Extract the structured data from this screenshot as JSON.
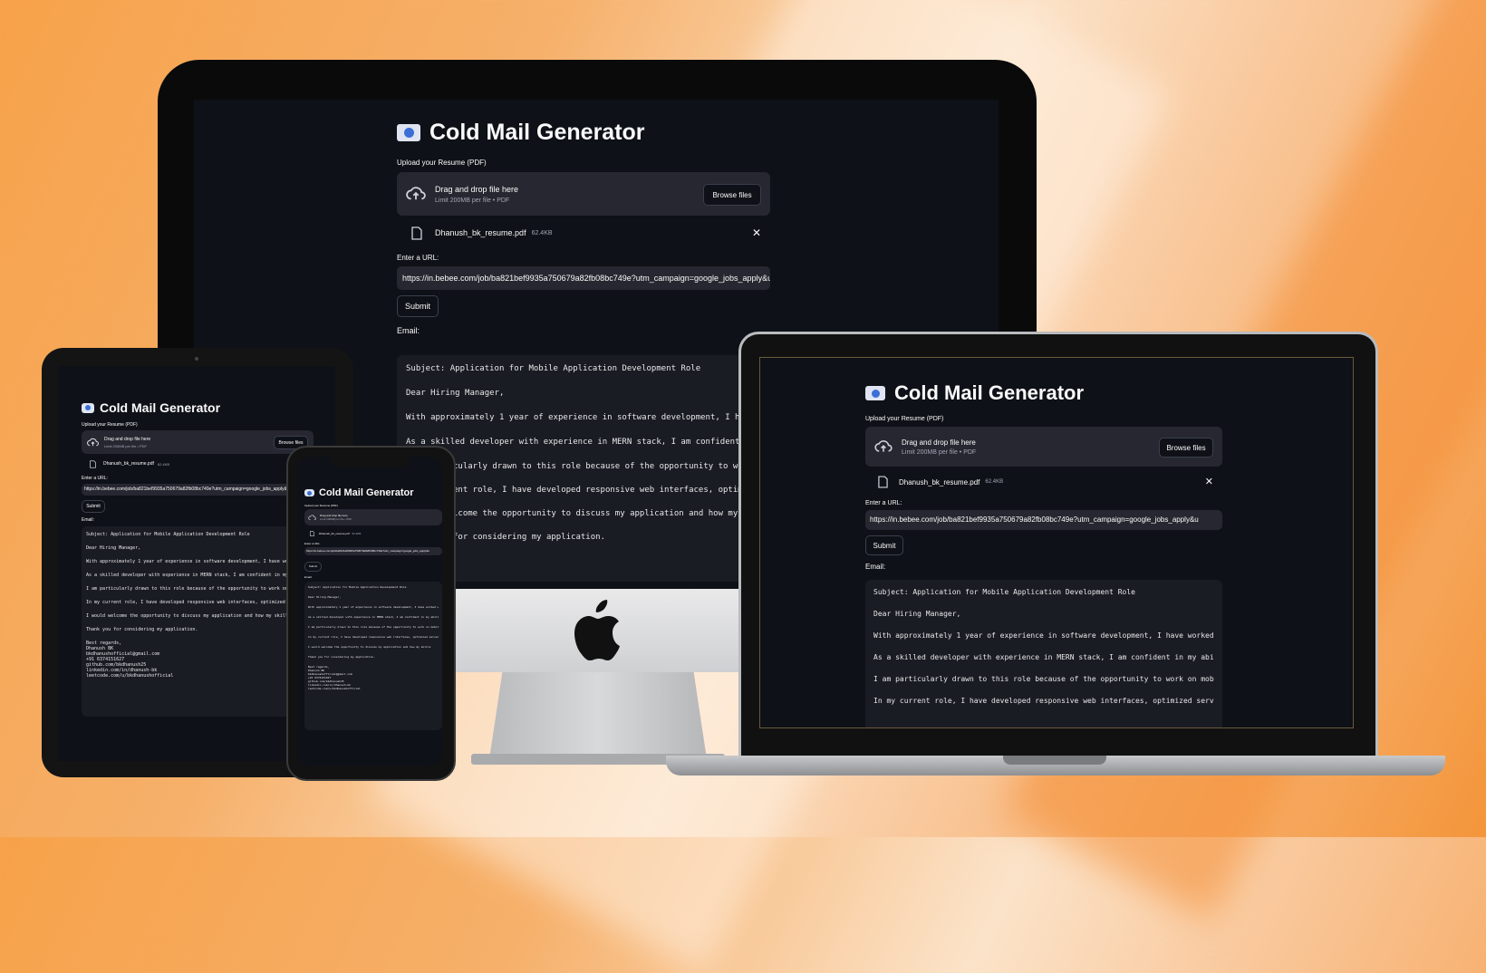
{
  "app": {
    "title": "Cold Mail Generator",
    "upload_label": "Upload your Resume (PDF)",
    "dropzone_main": "Drag and drop file here",
    "dropzone_sub": "Limit 200MB per file • PDF",
    "browse_label": "Browse files",
    "file_name": "Dhanush_bk_resume.pdf",
    "file_size": "62.4KB",
    "url_label": "Enter a URL:",
    "url_value": "https://in.bebee.com/job/ba821bef9935a750679a82fb08bc749e?utm_campaign=google_jobs_apply&u",
    "submit_label": "Submit",
    "email_label": "Email:"
  },
  "email": {
    "subject": "Subject: Application for Mobile Application Development Role",
    "greeting": "Dear Hiring Manager,",
    "p1": "With approximately 1 year of experience in software development, I have worked with",
    "p2": "As a skilled developer with experience in MERN stack, I am confident in my ability",
    "p3": "I am particularly drawn to this role because of the opportunity to work on mobile",
    "p4": "In my current role, I have developed responsive web interfaces, optimized server p",
    "p5": "I would welcome the opportunity to discuss my application and how my skills",
    "p6": "Thank you for considering my application.",
    "sign1": "Best regards,",
    "sign2": "Dhanush BK",
    "sign3": "bkdhanushofficial@gmail.com",
    "sign4": "+91 6374151627",
    "sign5": "github.com/bkdhanush25",
    "sign6": "linkedin.com/in/dhanush-bk",
    "sign7": "leetcode.com/u/bkdhanushofficial"
  },
  "imac_partial": {
    "p1": "With approximately 1 year of experience in software development, I have",
    "p2": "As a skilled developer with experience in MERN stack, I am confident in",
    "p3": "cularly drawn to this role because of the opportunity to work",
    "p4": "ent role, I have developed responsive web interfaces, optimize",
    "p5": "lcome the opportunity to discuss my application and how my sk",
    "p6": "for considering my application."
  },
  "colors": {
    "app_bg": "#0e1117",
    "panel_bg": "#262730",
    "code_bg": "#1a1c24",
    "text": "#fafafa"
  },
  "icons": [
    "upload-cloud-icon",
    "file-icon",
    "close-icon",
    "envelope-icon",
    "apple-logo"
  ]
}
